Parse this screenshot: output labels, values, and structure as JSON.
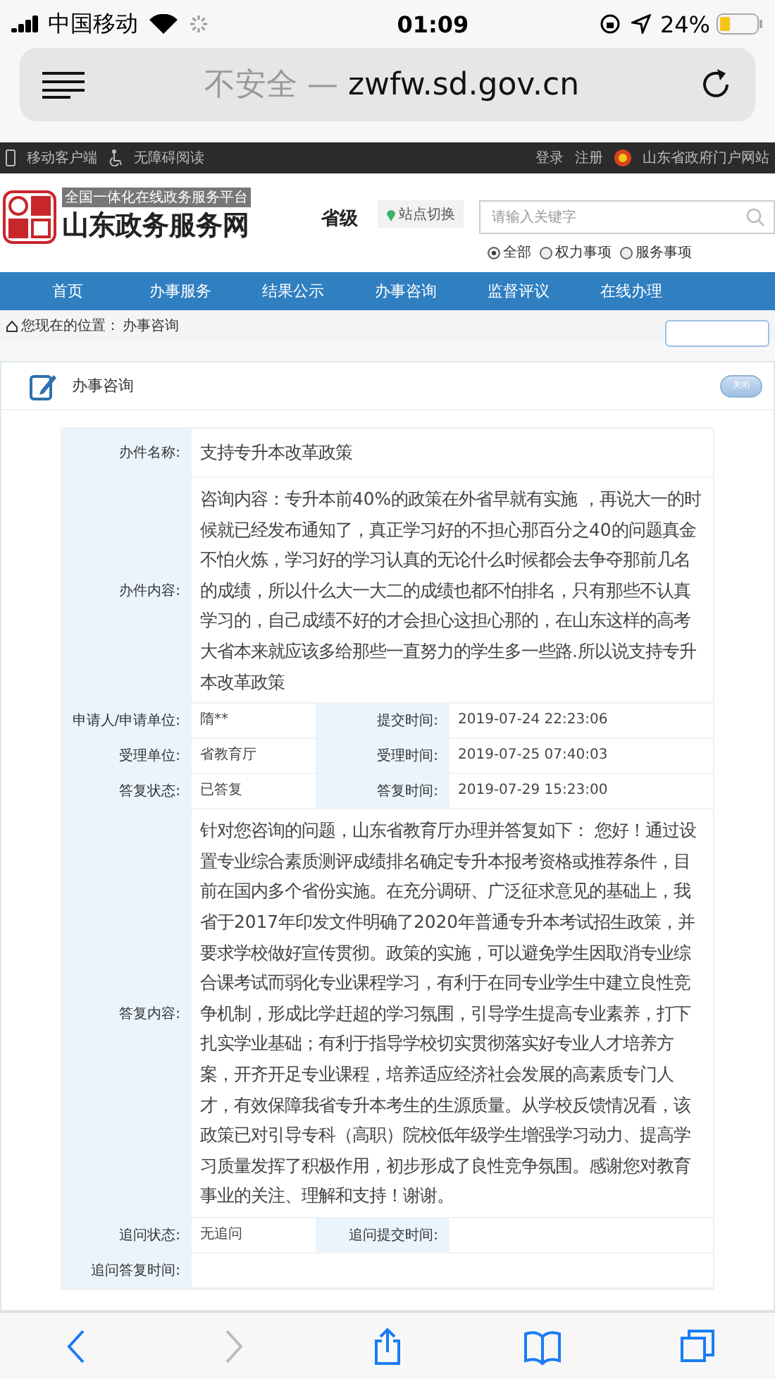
{
  "status_bar": {
    "carrier": "中国移动",
    "time": "01:09",
    "battery": "24%"
  },
  "browser": {
    "security": "不安全 —",
    "url": "zwfw.sd.gov.cn"
  },
  "top_bar": {
    "left": [
      "移动客户端",
      "无障碍阅读"
    ],
    "login": "登录",
    "register": "注册",
    "portal": "山东省政府门户网站"
  },
  "header": {
    "tagline": "全国一体化在线政务服务平台",
    "site_name": "山东政务服务网",
    "level": "省级",
    "switch": "站点切换",
    "search": {
      "placeholder": "请输入关键字"
    },
    "scopes": [
      {
        "label": "全部",
        "selected": true
      },
      {
        "label": "权力事项",
        "selected": false
      },
      {
        "label": "服务事项",
        "selected": false
      }
    ]
  },
  "nav": [
    {
      "label": "首页"
    },
    {
      "label": "办事服务"
    },
    {
      "label": "结果公示"
    },
    {
      "label": "办事咨询"
    },
    {
      "label": "监督评议"
    },
    {
      "label": "在线办理"
    }
  ],
  "breadcrumb": {
    "prefix": "您现在的位置：",
    "current": "办事咨询"
  },
  "panel": {
    "title": "办事咨询",
    "close": "关闭"
  },
  "rows": [
    {
      "kind": "single",
      "label": "办件名称:",
      "value": "支持专升本改革政策",
      "large": true
    },
    {
      "kind": "single",
      "label": "办件内容:",
      "value": "咨询内容：专升本前40%的政策在外省早就有实施 ，再说大一的时候就已经发布通知了，真正学习好的不担心那百分之40的问题真金不怕火炼，学习好的学习认真的无论什么时候都会去争夺那前几名的成绩，所以什么大一大二的成绩也都不怕排名，只有那些不认真学习的，自己成绩不好的才会担心这担心那的，在山东这样的高考大省本来就应该多给那些一直努力的学生多一些路.所以说支持专升本改革政策",
      "large": true
    },
    {
      "kind": "pair",
      "label": "申请人/申请单位:",
      "value": "隋**",
      "label2": "提交时间:",
      "value2": "2019-07-24 22:23:06"
    },
    {
      "kind": "pair",
      "label": "受理单位:",
      "value": "省教育厅",
      "label2": "受理时间:",
      "value2": "2019-07-25 07:40:03"
    },
    {
      "kind": "pair",
      "label": "答复状态:",
      "value": "已答复",
      "label2": "答复时间:",
      "value2": "2019-07-29 15:23:00"
    },
    {
      "kind": "single",
      "label": "答复内容:",
      "value": "针对您咨询的问题，山东省教育厅办理并答复如下： 您好！通过设置专业综合素质测评成绩排名确定专升本报考资格或推荐条件，目前在国内多个省份实施。在充分调研、广泛征求意见的基础上，我省于2017年印发文件明确了2020年普通专升本考试招生政策，并要求学校做好宣传贯彻。政策的实施，可以避免学生因取消专业综合课考试而弱化专业课程学习，有利于在同专业学生中建立良性竞争机制，形成比学赶超的学习氛围，引导学生提高专业素养，打下扎实学业基础；有利于指导学校切实贯彻落实好专业人才培养方案，开齐开足专业课程，培养适应经济社会发展的高素质专门人才，有效保障我省专升本考生的生源质量。从学校反馈情况看，该政策已对引导专科（高职）院校低年级学生增强学习动力、提高学习质量发挥了积极作用，初步形成了良性竞争氛围。感谢您对教育事业的关注、理解和支持！谢谢。",
      "large": true
    },
    {
      "kind": "pair",
      "label": "追问状态:",
      "value": "无追问",
      "label2": "追问提交时间:"
    },
    {
      "kind": "single",
      "label": "追问答复时间:",
      "large": false
    }
  ],
  "toolbar": [
    {
      "kind": "back",
      "disabled": false
    },
    {
      "kind": "forward",
      "disabled": true
    },
    {
      "kind": "share",
      "disabled": false
    },
    {
      "kind": "bookmarks",
      "disabled": false
    },
    {
      "kind": "tabs",
      "disabled": false
    }
  ]
}
